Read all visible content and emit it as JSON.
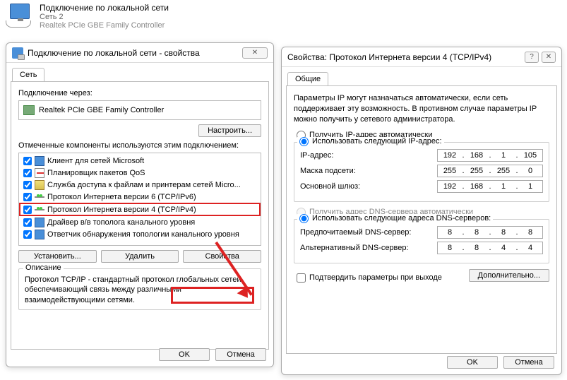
{
  "header": {
    "title": "Подключение по локальной сети",
    "network": "Сеть 2",
    "adapter": "Realtek PCIe GBE Family Controller"
  },
  "props_window": {
    "title": "Подключение по локальной сети - свойства",
    "close": "✕",
    "tab": "Сеть",
    "connect_label": "Подключение через:",
    "adapter": "Realtek PCIe GBE Family Controller",
    "configure_btn": "Настроить...",
    "components_label": "Отмеченные компоненты используются этим подключением:",
    "items": [
      {
        "label": "Клиент для сетей Microsoft",
        "icon": "ic-monitor"
      },
      {
        "label": "Планировщик пакетов QoS",
        "icon": "ic-sched"
      },
      {
        "label": "Служба доступа к файлам и принтерам сетей Micro...",
        "icon": "ic-folder"
      },
      {
        "label": "Протокол Интернета версии 6 (TCP/IPv6)",
        "icon": "ic-proto"
      },
      {
        "label": "Протокол Интернета версии 4 (TCP/IPv4)",
        "icon": "ic-proto"
      },
      {
        "label": "Драйвер в/в тополога канального уровня",
        "icon": "ic-driver"
      },
      {
        "label": "Ответчик обнаружения топологии канального уровня",
        "icon": "ic-responder"
      }
    ],
    "install_btn": "Установить...",
    "remove_btn": "Удалить",
    "properties_btn": "Свойства",
    "desc_title": "Описание",
    "desc_text": "Протокол TCP/IP - стандартный протокол глобальных сетей, обеспечивающий связь между различными взаимодействующими сетями.",
    "ok": "OK",
    "cancel": "Отмена"
  },
  "ipv4_window": {
    "title": "Свойства: Протокол Интернета версии 4 (TCP/IPv4)",
    "help": "?",
    "close": "✕",
    "tab": "Общие",
    "info": "Параметры IP могут назначаться автоматически, если сеть поддерживает эту возможность. В противном случае параметры IP можно получить у сетевого администратора.",
    "radio_auto_ip": "Получить IP-адрес автоматически",
    "radio_manual_ip": "Использовать следующий IP-адрес:",
    "ip_label": "IP-адрес:",
    "ip": [
      "192",
      "168",
      "1",
      "105"
    ],
    "mask_label": "Маска подсети:",
    "mask": [
      "255",
      "255",
      "255",
      "0"
    ],
    "gw_label": "Основной шлюз:",
    "gw": [
      "192",
      "168",
      "1",
      "1"
    ],
    "radio_auto_dns": "Получить адрес DNS-сервера автоматически",
    "radio_manual_dns": "Использовать следующие адреса DNS-серверов:",
    "dns1_label": "Предпочитаемый DNS-сервер:",
    "dns1": [
      "8",
      "8",
      "8",
      "8"
    ],
    "dns2_label": "Альтернативный DNS-сервер:",
    "dns2": [
      "8",
      "8",
      "4",
      "4"
    ],
    "confirm_checkbox": "Подтвердить параметры при выходе",
    "advanced_btn": "Дополнительно...",
    "ok": "OK",
    "cancel": "Отмена"
  }
}
